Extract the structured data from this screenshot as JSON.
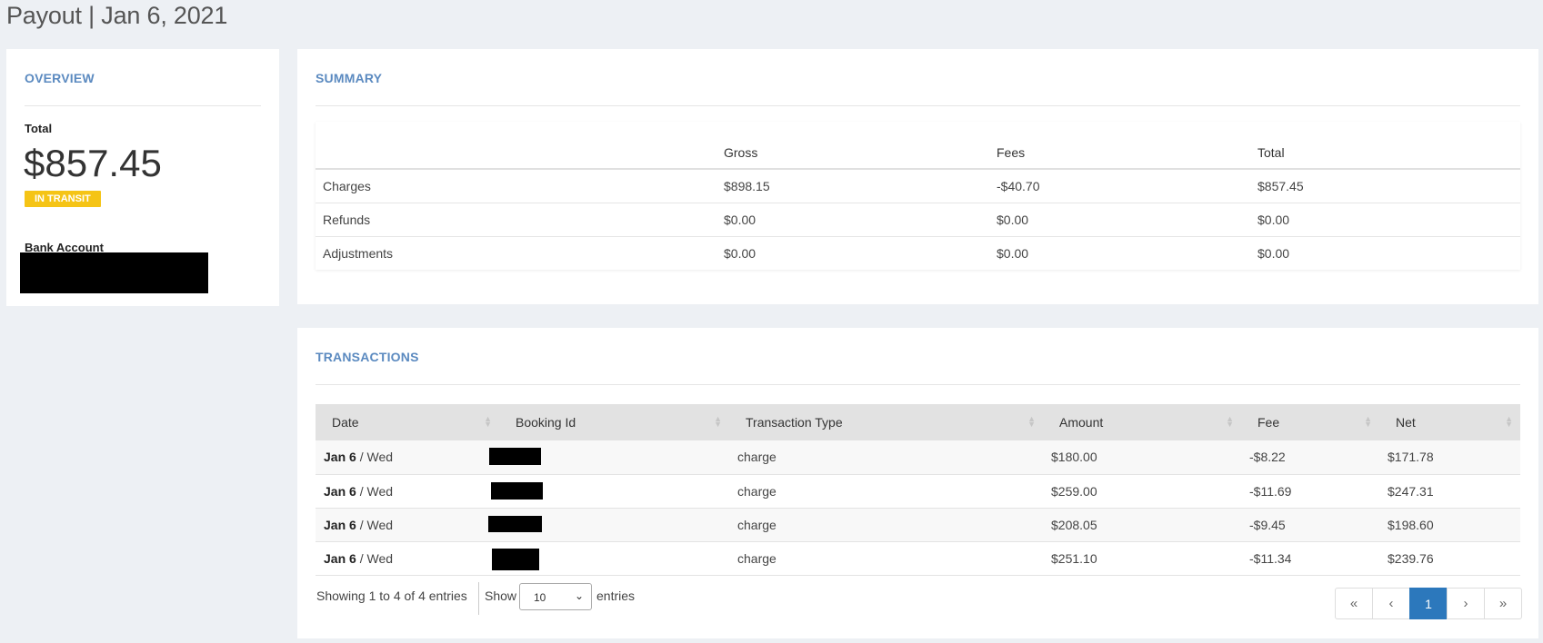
{
  "page": {
    "title": "Payout | Jan 6, 2021"
  },
  "overview": {
    "heading": "OVERVIEW",
    "total_label": "Total",
    "total_amount": "$857.45",
    "status_badge": "IN TRANSIT",
    "bank_account_label": "Bank Account"
  },
  "summary": {
    "heading": "SUMMARY",
    "columns": [
      "",
      "Gross",
      "Fees",
      "Total"
    ],
    "rows": [
      {
        "label": "Charges",
        "gross": "$898.15",
        "fees": "-$40.70",
        "total": "$857.45"
      },
      {
        "label": "Refunds",
        "gross": "$0.00",
        "fees": "$0.00",
        "total": "$0.00"
      },
      {
        "label": "Adjustments",
        "gross": "$0.00",
        "fees": "$0.00",
        "total": "$0.00"
      }
    ]
  },
  "transactions": {
    "heading": "TRANSACTIONS",
    "columns": [
      "Date",
      "Booking Id",
      "Transaction Type",
      "Amount",
      "Fee",
      "Net"
    ],
    "rows": [
      {
        "date_bold": "Jan 6",
        "date_rest": " / Wed",
        "type": "charge",
        "amount": "$180.00",
        "fee": "-$8.22",
        "net": "$171.78"
      },
      {
        "date_bold": "Jan 6",
        "date_rest": " / Wed",
        "type": "charge",
        "amount": "$259.00",
        "fee": "-$11.69",
        "net": "$247.31"
      },
      {
        "date_bold": "Jan 6",
        "date_rest": " / Wed",
        "type": "charge",
        "amount": "$208.05",
        "fee": "-$9.45",
        "net": "$198.60"
      },
      {
        "date_bold": "Jan 6",
        "date_rest": " / Wed",
        "type": "charge",
        "amount": "$251.10",
        "fee": "-$11.34",
        "net": "$239.76"
      }
    ],
    "info": "Showing 1 to 4 of 4 entries",
    "show_label": "Show",
    "page_size": "10",
    "entries_label": "entries",
    "pagination": {
      "first": "«",
      "prev": "‹",
      "current": "1",
      "next": "›",
      "last": "»"
    }
  },
  "icons": {
    "sort": "sort-icon",
    "dropdown": "chevron-down-icon"
  },
  "colors": {
    "accent": "#5b8ac0",
    "badge": "#f5c416",
    "page_active": "#2c78bc",
    "background": "#edf0f4"
  }
}
